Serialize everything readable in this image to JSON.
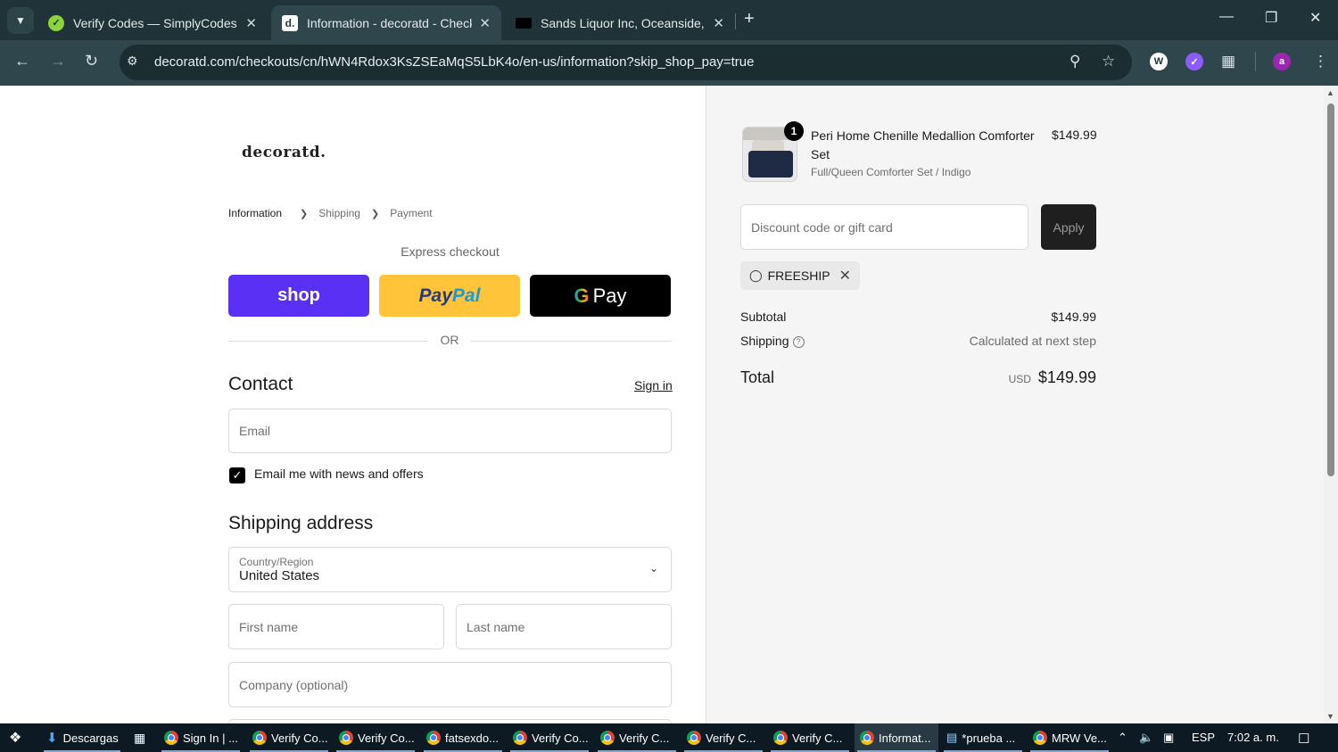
{
  "browser": {
    "tabs": [
      {
        "title": "Verify Codes — SimplyCodes",
        "favicon": "simplycodes-icon"
      },
      {
        "title": "Information - decoratd - Checkout",
        "favicon": "decoratd-icon",
        "active": true
      },
      {
        "title": "Sands Liquor Inc, Oceanside, NY",
        "favicon": "sands-icon"
      }
    ],
    "url": "decoratd.com/checkouts/cn/hWN4Rdox3KsZSEaMqS5LbK4o/en-us/information?skip_shop_pay=true",
    "profile_initial": "a"
  },
  "checkout": {
    "logo": "decoratd.",
    "breadcrumb": {
      "information": "Information",
      "shipping": "Shipping",
      "payment": "Payment"
    },
    "express_label": "Express checkout",
    "shop_label": "shop",
    "paypal_a": "Pay",
    "paypal_b": "Pal",
    "gpay_g": "G",
    "gpay_label": "Pay",
    "or_label": "OR",
    "contact_heading": "Contact",
    "sign_in": "Sign in",
    "email_placeholder": "Email",
    "news_label": "Email me with news and offers",
    "news_checked": true,
    "shipping_heading": "Shipping address",
    "country_label": "Country/Region",
    "country_value": "United States",
    "first_name_placeholder": "First name",
    "last_name_placeholder": "Last name",
    "company_placeholder": "Company (optional)"
  },
  "summary": {
    "item": {
      "quantity": "1",
      "name": "Peri Home Chenille Medallion Comforter Set",
      "variant": "Full/Queen Comforter Set / Indigo",
      "price": "$149.99"
    },
    "discount_placeholder": "Discount code or gift card",
    "apply_label": "Apply",
    "applied_code": "FREESHIP",
    "subtotal_label": "Subtotal",
    "subtotal_value": "$149.99",
    "shipping_label": "Shipping",
    "shipping_value": "Calculated at next step",
    "total_label": "Total",
    "currency": "USD",
    "total_value": "$149.99"
  },
  "taskbar": {
    "items": [
      {
        "label": "Descargas"
      },
      {
        "label": "Sign In | ..."
      },
      {
        "label": "Verify Co..."
      },
      {
        "label": "Verify Co..."
      },
      {
        "label": "fatsexdo..."
      },
      {
        "label": "Verify Co..."
      },
      {
        "label": "Verify C..."
      },
      {
        "label": "Verify C..."
      },
      {
        "label": "Verify C..."
      },
      {
        "label": "Informat...",
        "active": true
      },
      {
        "label": "*prueba ..."
      },
      {
        "label": "MRW Ve..."
      }
    ],
    "language": "ESP",
    "time": "7:02 a. m."
  }
}
